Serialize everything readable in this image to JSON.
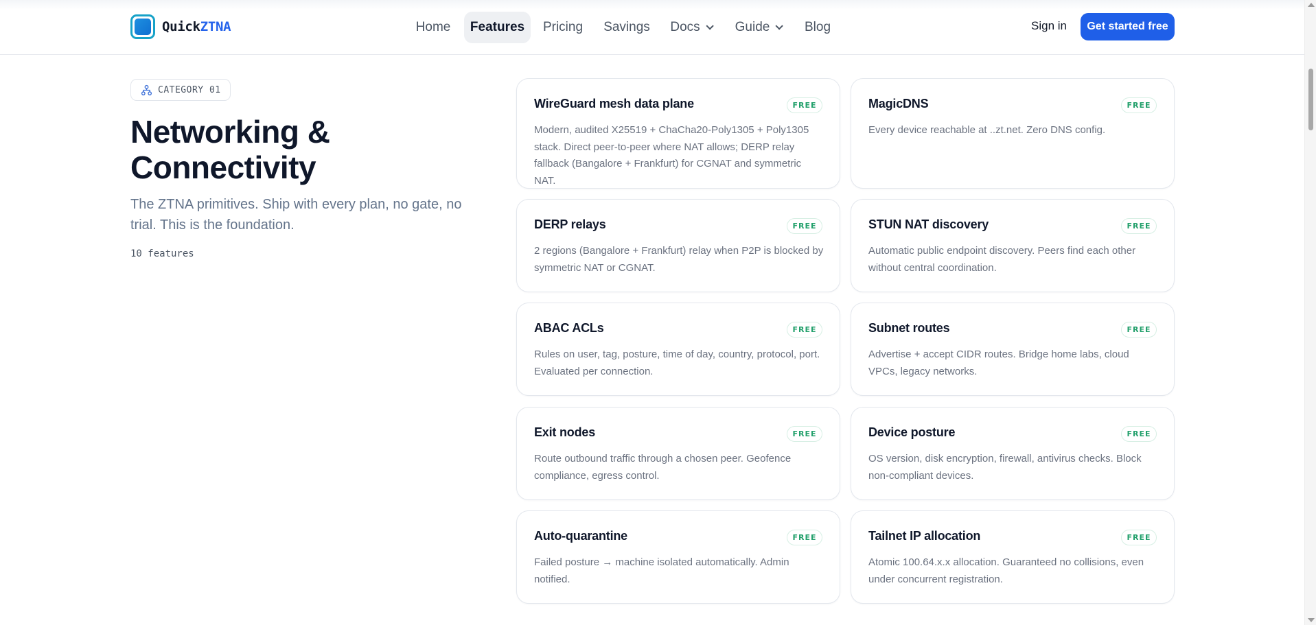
{
  "brand": {
    "name_prefix": "Quick",
    "name_accent": "ZTNA"
  },
  "nav": {
    "items": [
      {
        "label": "Home"
      },
      {
        "label": "Features"
      },
      {
        "label": "Pricing"
      },
      {
        "label": "Savings"
      },
      {
        "label": "Docs"
      },
      {
        "label": "Guide"
      },
      {
        "label": "Blog"
      }
    ],
    "active": "Features",
    "sign_in": "Sign in",
    "cta": "Get started free"
  },
  "category": {
    "badge": "CATEGORY 01",
    "title": "Networking & Connectivity",
    "description": "The ZTNA primitives. Ship with every plan, no gate, no trial. This is the foundation.",
    "count": "10 features"
  },
  "features": [
    {
      "title": "WireGuard mesh data plane",
      "badge": "FREE",
      "description": "Modern, audited X25519 + ChaCha20-Poly1305 + Poly1305 stack. Direct peer-to-peer where NAT allows; DERP relay fallback (Bangalore + Frankfurt) for CGNAT and symmetric NAT."
    },
    {
      "title": "MagicDNS",
      "badge": "FREE",
      "description": "Every device reachable at ..zt.net. Zero DNS config."
    },
    {
      "title": "DERP relays",
      "badge": "FREE",
      "description": "2 regions (Bangalore + Frankfurt) relay when P2P is blocked by symmetric NAT or CGNAT."
    },
    {
      "title": "STUN NAT discovery",
      "badge": "FREE",
      "description": "Automatic public endpoint discovery. Peers find each other without central coordination."
    },
    {
      "title": "ABAC ACLs",
      "badge": "FREE",
      "description": "Rules on user, tag, posture, time of day, country, protocol, port. Evaluated per connection."
    },
    {
      "title": "Subnet routes",
      "badge": "FREE",
      "description": "Advertise + accept CIDR routes. Bridge home labs, cloud VPCs, legacy networks."
    },
    {
      "title": "Exit nodes",
      "badge": "FREE",
      "description": "Route outbound traffic through a chosen peer. Geofence compliance, egress control."
    },
    {
      "title": "Device posture",
      "badge": "FREE",
      "description": "OS version, disk encryption, firewall, antivirus checks. Block non-compliant devices."
    },
    {
      "title": "Auto-quarantine",
      "badge": "FREE",
      "description": "Failed posture → machine isolated automatically. Admin notified."
    },
    {
      "title": "Tailnet IP allocation",
      "badge": "FREE",
      "description": "Atomic 100.64.x.x allocation. Guaranteed no collisions, even under concurrent registration."
    }
  ],
  "colors": {
    "accent": "#1f5fe8",
    "free_badge": "#22a06b",
    "logo_ring": "#17a2c8"
  }
}
